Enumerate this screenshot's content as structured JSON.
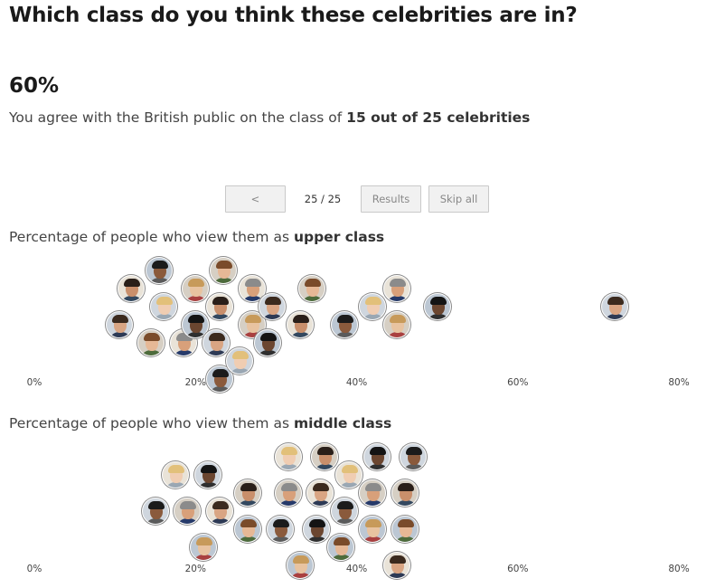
{
  "title": "Which class do you think these celebrities are in?",
  "score": "60%",
  "agreement": {
    "prefix": "You agree with the British public on the class of ",
    "bold": "15 out of 25 celebrities"
  },
  "nav": {
    "prev_label": "<",
    "counter": "25 / 25",
    "results_label": "Results",
    "skip_label": "Skip all"
  },
  "sections": {
    "upper": {
      "prefix": "Percentage of people who view them as ",
      "class_name": "upper class"
    },
    "middle": {
      "prefix": "Percentage of people who view them as ",
      "class_name": "middle class"
    }
  },
  "colors": {
    "ring": "#8a8a8a",
    "button_bg": "#f1f1f1",
    "button_border": "#c9c9c9"
  },
  "chart_data": [
    {
      "type": "scatter",
      "title": "Percentage of people who view them as upper class",
      "xlim": [
        0,
        80
      ],
      "x_ticks": [
        "0%",
        "20%",
        "40%",
        "60%",
        "80%"
      ],
      "points": [
        {
          "x": 10.5,
          "row": 3
        },
        {
          "x": 12,
          "row": 1
        },
        {
          "x": 14.5,
          "row": 4
        },
        {
          "x": 15.5,
          "row": 0
        },
        {
          "x": 16,
          "row": 2
        },
        {
          "x": 18.5,
          "row": 4
        },
        {
          "x": 20,
          "row": 1
        },
        {
          "x": 20,
          "row": 3
        },
        {
          "x": 22.5,
          "row": 4
        },
        {
          "x": 23,
          "row": 2
        },
        {
          "x": 23.5,
          "row": 0
        },
        {
          "x": 23,
          "row": 6
        },
        {
          "x": 25.5,
          "row": 5
        },
        {
          "x": 27,
          "row": 1
        },
        {
          "x": 27,
          "row": 3
        },
        {
          "x": 29,
          "row": 4
        },
        {
          "x": 29.5,
          "row": 2
        },
        {
          "x": 33,
          "row": 3
        },
        {
          "x": 34.5,
          "row": 1
        },
        {
          "x": 38.5,
          "row": 3
        },
        {
          "x": 42,
          "row": 2
        },
        {
          "x": 45,
          "row": 1
        },
        {
          "x": 45,
          "row": 3
        },
        {
          "x": 50,
          "row": 2
        },
        {
          "x": 72,
          "row": 2
        }
      ]
    },
    {
      "type": "scatter",
      "title": "Percentage of people who view them as middle class",
      "xlim": [
        0,
        80
      ],
      "x_ticks": [
        "0%",
        "20%",
        "40%",
        "60%",
        "80%"
      ],
      "points": [
        {
          "x": 15,
          "row": 3
        },
        {
          "x": 17.5,
          "row": 1
        },
        {
          "x": 19,
          "row": 3
        },
        {
          "x": 21,
          "row": 5
        },
        {
          "x": 21.5,
          "row": 1
        },
        {
          "x": 23,
          "row": 3
        },
        {
          "x": 26.5,
          "row": 2
        },
        {
          "x": 26.5,
          "row": 4
        },
        {
          "x": 30.5,
          "row": 4
        },
        {
          "x": 31.5,
          "row": 0
        },
        {
          "x": 31.5,
          "row": 2
        },
        {
          "x": 33,
          "row": 6
        },
        {
          "x": 35,
          "row": 4
        },
        {
          "x": 35.5,
          "row": 2
        },
        {
          "x": 36,
          "row": 0
        },
        {
          "x": 38,
          "row": 5
        },
        {
          "x": 38.5,
          "row": 3
        },
        {
          "x": 39,
          "row": 1
        },
        {
          "x": 42,
          "row": 2
        },
        {
          "x": 42,
          "row": 4
        },
        {
          "x": 42.5,
          "row": 0
        },
        {
          "x": 45,
          "row": 6
        },
        {
          "x": 46,
          "row": 2
        },
        {
          "x": 46,
          "row": 4
        },
        {
          "x": 47,
          "row": 0
        }
      ]
    }
  ]
}
